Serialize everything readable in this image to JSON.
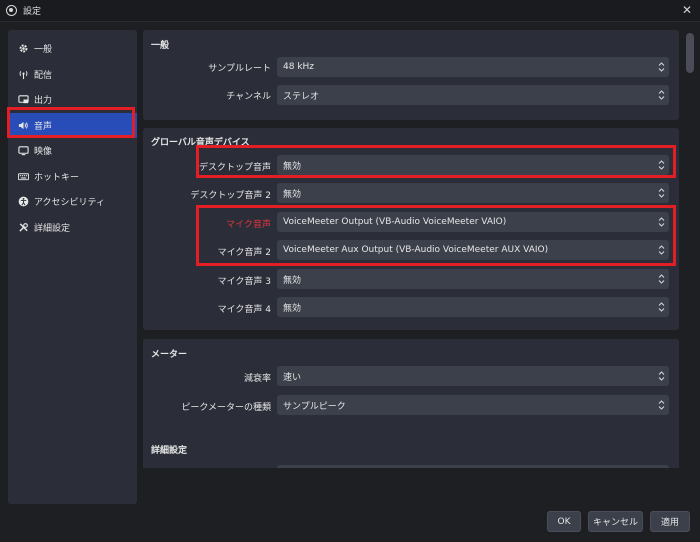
{
  "window": {
    "title": "設定"
  },
  "sidebar": {
    "items": [
      {
        "label": "一般",
        "icon": "gear-icon"
      },
      {
        "label": "配信",
        "icon": "antenna-icon"
      },
      {
        "label": "出力",
        "icon": "output-icon"
      },
      {
        "label": "音声",
        "icon": "speaker-icon"
      },
      {
        "label": "映像",
        "icon": "monitor-icon"
      },
      {
        "label": "ホットキー",
        "icon": "keyboard-icon"
      },
      {
        "label": "アクセシビリティ",
        "icon": "accessibility-icon"
      },
      {
        "label": "詳細設定",
        "icon": "tools-icon"
      }
    ],
    "selected": "音声"
  },
  "general": {
    "title": "一般",
    "sample_rate_label": "サンプルレート",
    "sample_rate_value": "48 kHz",
    "channels_label": "チャンネル",
    "channels_value": "ステレオ"
  },
  "global_audio": {
    "title": "グローバル音声デバイス",
    "desktop1_label": "デスクトップ音声",
    "desktop1_value": "無効",
    "desktop2_label": "デスクトップ音声 2",
    "desktop2_value": "無効",
    "mic1_label": "マイク音声",
    "mic1_value": "VoiceMeeter Output (VB-Audio VoiceMeeter VAIO)",
    "mic2_label": "マイク音声 2",
    "mic2_value": "VoiceMeeter Aux Output (VB-Audio VoiceMeeter AUX VAIO)",
    "mic3_label": "マイク音声 3",
    "mic3_value": "無効",
    "mic4_label": "マイク音声 4",
    "mic4_value": "無効"
  },
  "meters": {
    "title": "メーター",
    "decay_label": "減衰率",
    "decay_value": "速い",
    "peak_label": "ピークメーターの種類",
    "peak_value": "サンプルピーク"
  },
  "advanced": {
    "title": "詳細設定"
  },
  "buttons": {
    "ok": "OK",
    "cancel": "キャンセル",
    "apply": "適用"
  },
  "colors": {
    "selected": "#284cb8",
    "highlight": "#e31e25",
    "label_red": "#e0373c"
  }
}
